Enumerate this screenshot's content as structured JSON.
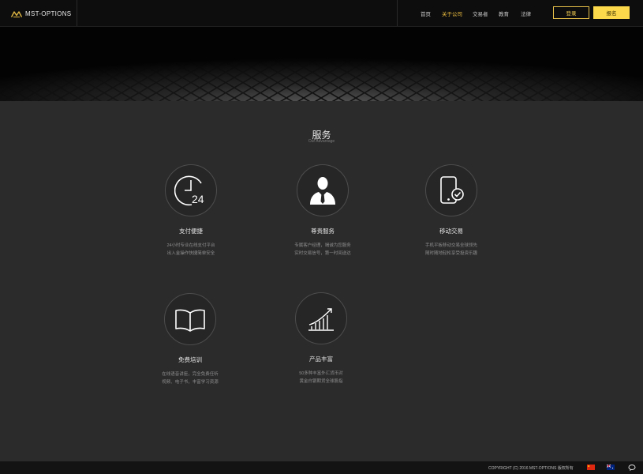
{
  "header": {
    "logo_text": "MST-OPTIONS",
    "nav": [
      "首页",
      "关于公司",
      "交易者",
      "教育",
      "法律"
    ],
    "login_label": "登录",
    "register_label": "报名"
  },
  "section": {
    "title": "服务",
    "subtitle": "Our Advantage"
  },
  "features": [
    {
      "icon": "clock-24-icon",
      "title": "支付便捷",
      "desc1": "24小时专业在线支付平台",
      "desc2": "出入金操作快捷简单安全"
    },
    {
      "icon": "business-person-icon",
      "title": "尊贵服务",
      "desc1": "专属客户经理，竭诚为您服务",
      "desc2": "实时交易信号，第一时间送达"
    },
    {
      "icon": "mobile-check-icon",
      "title": "移动交易",
      "desc1": "手机平板移动交易全球领先",
      "desc2": "随时随地轻松享受投资乐趣"
    },
    {
      "icon": "open-book-icon",
      "title": "免费培训",
      "desc1": "在线语音讲座，完全免费任听",
      "desc2": "视频、电子书，丰富学习资源"
    },
    {
      "icon": "rising-chart-icon",
      "title": "产品丰富",
      "desc1": "50多种丰富外汇货币对",
      "desc2": "黄金白银期货全球股指"
    }
  ],
  "footer": {
    "copyright": "COPYRIGHT (C) 2016 MST-OPTIONS 版权所有"
  },
  "colors": {
    "accent": "#fcd84b",
    "background": "#2b2b2c",
    "header": "#0d0d0d"
  }
}
